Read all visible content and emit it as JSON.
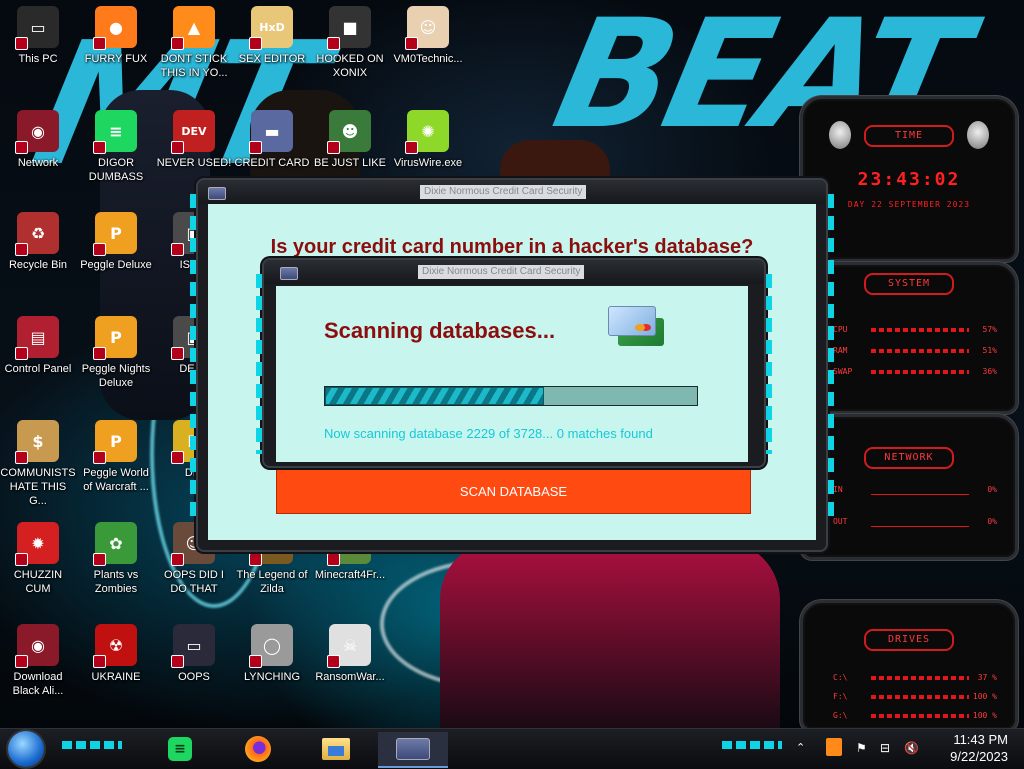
{
  "desktop": {
    "graffiti": [
      "MT",
      "BEAT"
    ],
    "icons": [
      {
        "label": "This PC",
        "icon": "computer-icon",
        "color": "#2a2a2a",
        "glyph": "▭"
      },
      {
        "label": "FURRY FUX",
        "icon": "firefox-icon",
        "color": "#ff7a1a",
        "glyph": "●"
      },
      {
        "label": "DONT STICK THIS IN YO...",
        "icon": "vlc-cone-icon",
        "color": "#ff8c1a",
        "glyph": "▲"
      },
      {
        "label": "SEX EDITOR",
        "icon": "hxd-icon",
        "color": "#e8c878",
        "glyph": "HxD"
      },
      {
        "label": "HOOKED ON XONIX",
        "icon": "xonix-icon",
        "color": "#333333",
        "glyph": "■"
      },
      {
        "label": "VM0Technic...",
        "icon": "doctor-icon",
        "color": "#e8d0b0",
        "glyph": "☺"
      },
      {
        "label": "Network",
        "icon": "alien-orb-icon",
        "color": "#8a1a2a",
        "glyph": "◉"
      },
      {
        "label": "DIGOR DUMBASS",
        "icon": "spotify-green-icon",
        "color": "#1ed760",
        "glyph": "≡"
      },
      {
        "label": "NEVER USED!",
        "icon": "devcpp-icon",
        "color": "#c02020",
        "glyph": "DEV"
      },
      {
        "label": "CREDIT CARD",
        "icon": "credit-card-app-icon",
        "color": "#5a6aa0",
        "glyph": "▬"
      },
      {
        "label": "BE JUST LIKE",
        "icon": "elf-icon",
        "color": "#3a7a3a",
        "glyph": "☻"
      },
      {
        "label": "VirusWire.exe",
        "icon": "lime-icon",
        "color": "#8ed82a",
        "glyph": "✺"
      },
      {
        "label": "Recycle Bin",
        "icon": "recycle-bin-icon",
        "color": "#b03030",
        "glyph": "♻"
      },
      {
        "label": "Peggle Deluxe",
        "icon": "peggle-icon",
        "color": "#f0a020",
        "glyph": "P"
      },
      {
        "label": "ISRAI",
        "icon": "app-icon",
        "color": "#4a4a4a",
        "glyph": "▣"
      },
      {
        "label": "Control Panel",
        "icon": "control-panel-icon",
        "color": "#b02030",
        "glyph": "▤"
      },
      {
        "label": "Peggle Nights Deluxe",
        "icon": "peggle-nights-icon",
        "color": "#f0a020",
        "glyph": "P"
      },
      {
        "label": "DEEZ",
        "icon": "app-icon",
        "color": "#4a4a4a",
        "glyph": "▣"
      },
      {
        "label": "COMMUNISTS HATE THIS G...",
        "icon": "money-bag-icon",
        "color": "#c89a50",
        "glyph": "$"
      },
      {
        "label": "Peggle World of Warcraft ...",
        "icon": "peggle-wow-icon",
        "color": "#f0a020",
        "glyph": "P"
      },
      {
        "label": "DIE",
        "icon": "app-icon",
        "color": "#d8b020",
        "glyph": "D"
      },
      {
        "label": "CHUZZIN CUM",
        "icon": "chuzzle-icon",
        "color": "#d42020",
        "glyph": "✹"
      },
      {
        "label": "Plants vs Zombies",
        "icon": "plants-vs-zombies-icon",
        "color": "#3a9a3a",
        "glyph": "✿"
      },
      {
        "label": "OOPS DID I DO THAT",
        "icon": "person-icon",
        "color": "#6a4a3a",
        "glyph": "☺"
      },
      {
        "label": "The Legend of Zilda",
        "icon": "zelda-icon",
        "color": "#7a5a20",
        "glyph": "▲"
      },
      {
        "label": "Minecraft4Fr...",
        "icon": "minecraft-icon",
        "color": "#5a8a3a",
        "glyph": "■"
      },
      {
        "label": "Download Black Ali...",
        "icon": "alien-orb-icon",
        "color": "#8a1a2a",
        "glyph": "◉"
      },
      {
        "label": "UKRAINE",
        "icon": "radiation-icon",
        "color": "#c01010",
        "glyph": "☢"
      },
      {
        "label": "OOPS",
        "icon": "monitor-icon",
        "color": "#2a2a3a",
        "glyph": "▭"
      },
      {
        "label": "LYNCHING",
        "icon": "rope-icon",
        "color": "#9a9a9a",
        "glyph": "◯"
      },
      {
        "label": "RansomWar...",
        "icon": "skull-icon",
        "color": "#e0e0e0",
        "glyph": "☠"
      }
    ]
  },
  "gadgets": {
    "time": {
      "header": "TIME",
      "clock": "23:43:02",
      "date": "DAY 22 SEPTEMBER 2023"
    },
    "system": {
      "header": "SYSTEM",
      "rows": [
        {
          "label": "CPU",
          "value": "57%"
        },
        {
          "label": "RAM",
          "value": "51%"
        },
        {
          "label": "SWAP",
          "value": "36%"
        }
      ]
    },
    "network": {
      "header": "NETWORK",
      "rows": [
        {
          "label": "IN",
          "value": "0%"
        },
        {
          "label": "OUT",
          "value": "0%"
        }
      ]
    },
    "drives": {
      "header": "DRIVES",
      "rows": [
        {
          "label": "C:\\",
          "value": "37 %"
        },
        {
          "label": "F:\\",
          "value": "100 %"
        },
        {
          "label": "G:\\",
          "value": "100 %"
        }
      ]
    }
  },
  "main_window": {
    "title": "Dixie Normous Credit Card Security",
    "question": "Is your credit card number in a hacker's database?",
    "scan_button": "SCAN DATABASE"
  },
  "scan_dialog": {
    "title": "Dixie Normous Credit Card Security",
    "heading": "Scanning databases...",
    "progress": 0.59,
    "status": "Now scanning database 2229 of 3728... 0 matches found"
  },
  "taskbar": {
    "apps": [
      {
        "name": "spotify",
        "icon": "spotify-green-icon"
      },
      {
        "name": "firefox",
        "icon": "firefox-icon"
      },
      {
        "name": "file-explorer",
        "icon": "folder-icon"
      },
      {
        "name": "credit-card-app",
        "icon": "credit-card-app-icon"
      }
    ],
    "tray_icons": [
      "caret-up-icon",
      "hardware-icon",
      "flag-icon",
      "network-icon",
      "muted-speaker-icon"
    ],
    "time": "11:43 PM",
    "date": "9/22/2023"
  },
  "colors": {
    "accent_cyan": "#0fd4e6",
    "gadget_red": "#ff3838",
    "scan_button": "#ff4a12",
    "client_bg": "#c8f6ef",
    "heading_red": "#8b0d0d"
  }
}
